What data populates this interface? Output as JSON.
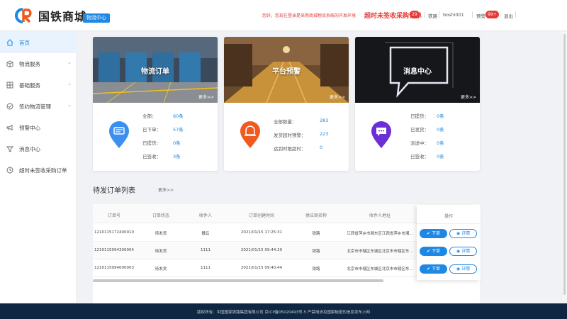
{
  "brand": {
    "name": "国铁商城",
    "badge": "物流中心"
  },
  "header": {
    "welcome": "您好，您现在登录是采购商城物流系统的开发环境",
    "alert": "超时未签收采购订单",
    "alert_count": "29",
    "links": [
      "铁路",
      "boshi001",
      "预警中心",
      "退出"
    ],
    "warning_count": "99+"
  },
  "sidebar": {
    "items": [
      {
        "label": "首页",
        "icon": "home-icon",
        "expandable": false,
        "active": true
      },
      {
        "label": "物流服务",
        "icon": "box-icon",
        "expandable": true,
        "active": false
      },
      {
        "label": "基础服务",
        "icon": "grid-icon",
        "expandable": true,
        "active": false
      },
      {
        "label": "签约物流管理",
        "icon": "contract-icon",
        "expandable": true,
        "active": false
      },
      {
        "label": "预警中心",
        "icon": "megaphone-icon",
        "expandable": false,
        "active": false
      },
      {
        "label": "消息中心",
        "icon": "bell-icon",
        "expandable": false,
        "active": false
      },
      {
        "label": "超时未签收采购订单",
        "icon": "clock-icon",
        "expandable": false,
        "active": false
      }
    ]
  },
  "cards": [
    {
      "title": "物流订单",
      "more": "更多>>",
      "icon": "truck-icon",
      "icon_color": "#3b8ff0",
      "stats": [
        {
          "label": "全部：",
          "value": "60条"
        },
        {
          "label": "已下单：",
          "value": "57条"
        },
        {
          "label": "已提货：",
          "value": "0条"
        },
        {
          "label": "已签收：",
          "value": "3条"
        }
      ]
    },
    {
      "title": "平台预警",
      "more": "更多>>",
      "icon": "alarm-icon",
      "icon_color": "#f05a1e",
      "stats": [
        {
          "label": "全部数量：",
          "value": "283"
        },
        {
          "label": "发货超时预警：",
          "value": "223"
        },
        {
          "label": "运到时限超时：",
          "value": "0"
        }
      ]
    },
    {
      "title": "消息中心",
      "more": "更多>>",
      "icon": "chat-icon",
      "icon_color": "#6b2fd6",
      "stats": [
        {
          "label": "已提货：",
          "value": "0条"
        },
        {
          "label": "已发货：",
          "value": "0条"
        },
        {
          "label": "派送中：",
          "value": "0条"
        },
        {
          "label": "已签收：",
          "value": "0条"
        }
      ]
    }
  ],
  "orders": {
    "title": "待发订单列表",
    "more": "更多>>",
    "columns": [
      "订单号",
      "订单状态",
      "收件人",
      "订单创建时间",
      "供应商名称",
      "收件人地址"
    ],
    "rows": [
      [
        "1210115172400010",
        "待发货",
        "魏云",
        "2021/01/15 17:25:31",
        "铁路",
        "江西省萍乡市湘东区江西省萍乡市湘..."
      ],
      [
        "1210115094300004",
        "待发货",
        "1111",
        "2021/01/15 09:44:20",
        "铁路",
        "北京市市辖区东城区北京市市辖区东..."
      ],
      [
        "1210115094000003",
        "待发货",
        "1111",
        "2021/01/15 09:40:44",
        "铁路",
        "北京市市辖区东城区北京市市辖区东..."
      ]
    ],
    "ops_title": "操作",
    "order_button": "下单",
    "detail_button": "详情"
  },
  "footer": {
    "text": "版权所有：中国国家铁路集团有限公司  京ICP备05020493号-5  严禁用涉及国家秘密的信息发布上网"
  },
  "colors": {
    "primary": "#1e88e5",
    "alert": "#e53935",
    "footer_bg": "#0f2742"
  }
}
